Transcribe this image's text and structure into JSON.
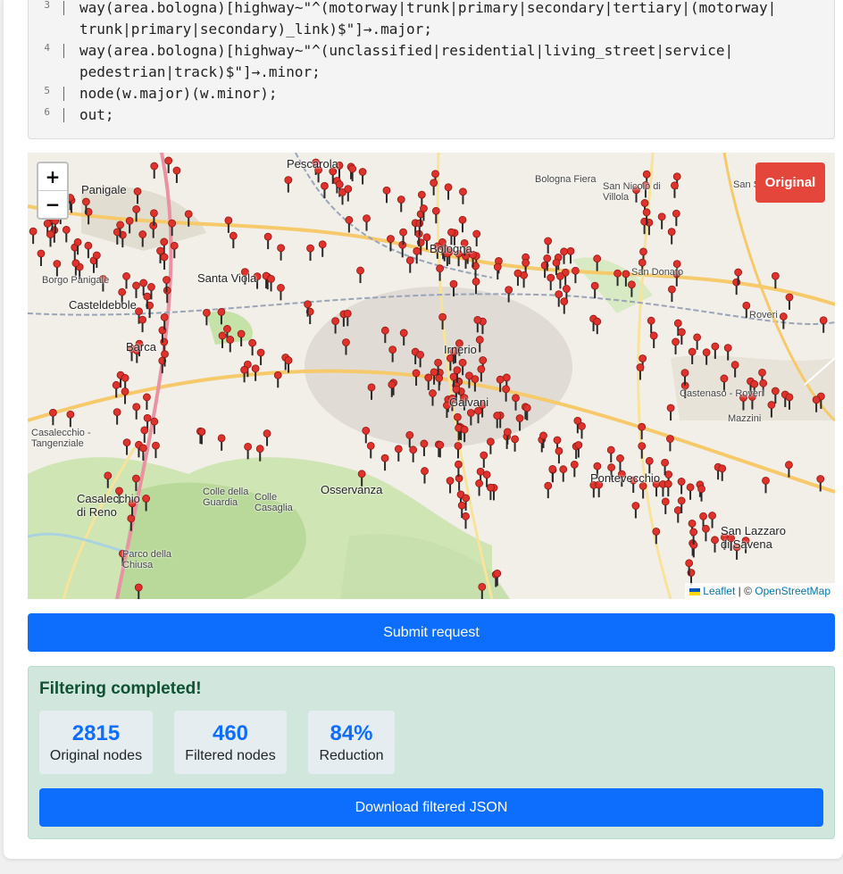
{
  "code": {
    "lines": [
      {
        "num": "3",
        "text": "way(area.bologna)[highway~\"^(motorway|trunk|primary|secondary|tertiary|(motorway|",
        "cont": "trunk|primary|secondary)_link)$\"]→.major;"
      },
      {
        "num": "4",
        "text": "way(area.bologna)[highway~\"^(unclassified|residential|living_street|service|",
        "cont": "pedestrian|track)$\"]→.minor;"
      },
      {
        "num": "5",
        "text": "node(w.major)(w.minor);",
        "cont": ""
      },
      {
        "num": "6",
        "text": "out;",
        "cont": ""
      }
    ]
  },
  "map": {
    "zoom_in": "+",
    "zoom_out": "−",
    "toggle_label": "Original",
    "attribution_leaflet": "Leaflet",
    "attribution_sep": " | © ",
    "attribution_osm": "OpenStreetMap",
    "place_labels": [
      "Pescarola",
      "Panigale",
      "Borgo Panigale",
      "Santa Viola",
      "Casteldebole",
      "Barca",
      "Casalecchio di Reno",
      "Casalecchio - Tangenziale",
      "Bologna",
      "Irnerio",
      "Galvani",
      "Osservanza",
      "Colle della Guardia",
      "Colle Casaglia",
      "Parco della Chiusa",
      "Pontevecchio",
      "San Donato",
      "Roveri",
      "Mazzini",
      "San Lazzaro di Savena",
      "San Nicolò di Villola",
      "San Sisto",
      "Bologna Fiera",
      "Castenaso - Roveri"
    ],
    "marker_color": "#e0322c"
  },
  "submit_label": "Submit request",
  "result": {
    "title": "Filtering completed!",
    "stats": [
      {
        "value": "2815",
        "label": "Original nodes"
      },
      {
        "value": "460",
        "label": "Filtered nodes"
      },
      {
        "value": "84%",
        "label": "Reduction"
      }
    ],
    "download_label": "Download filtered JSON"
  }
}
